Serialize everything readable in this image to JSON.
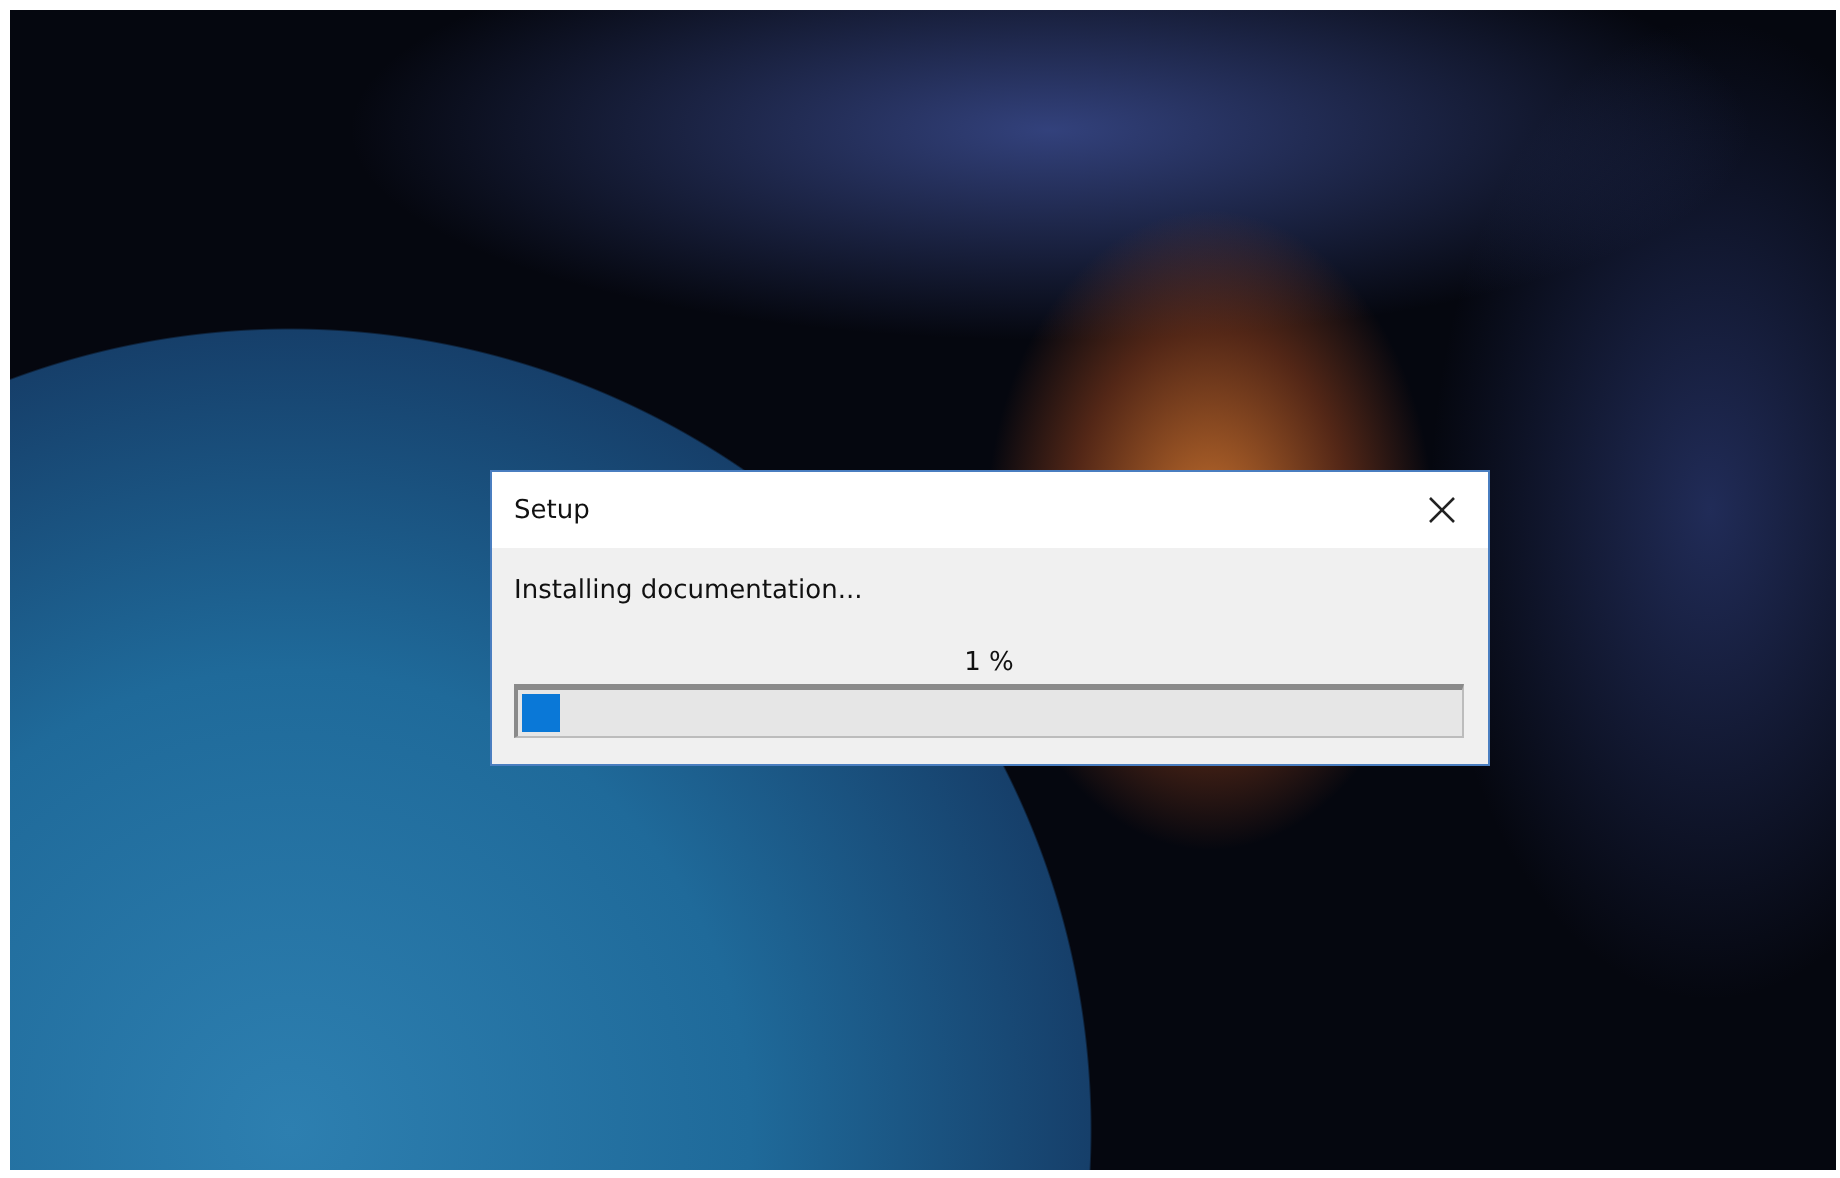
{
  "window": {
    "title": "Setup"
  },
  "status": {
    "message": "Installing documentation...",
    "percent_label": "1 %",
    "level": 0.04
  }
}
